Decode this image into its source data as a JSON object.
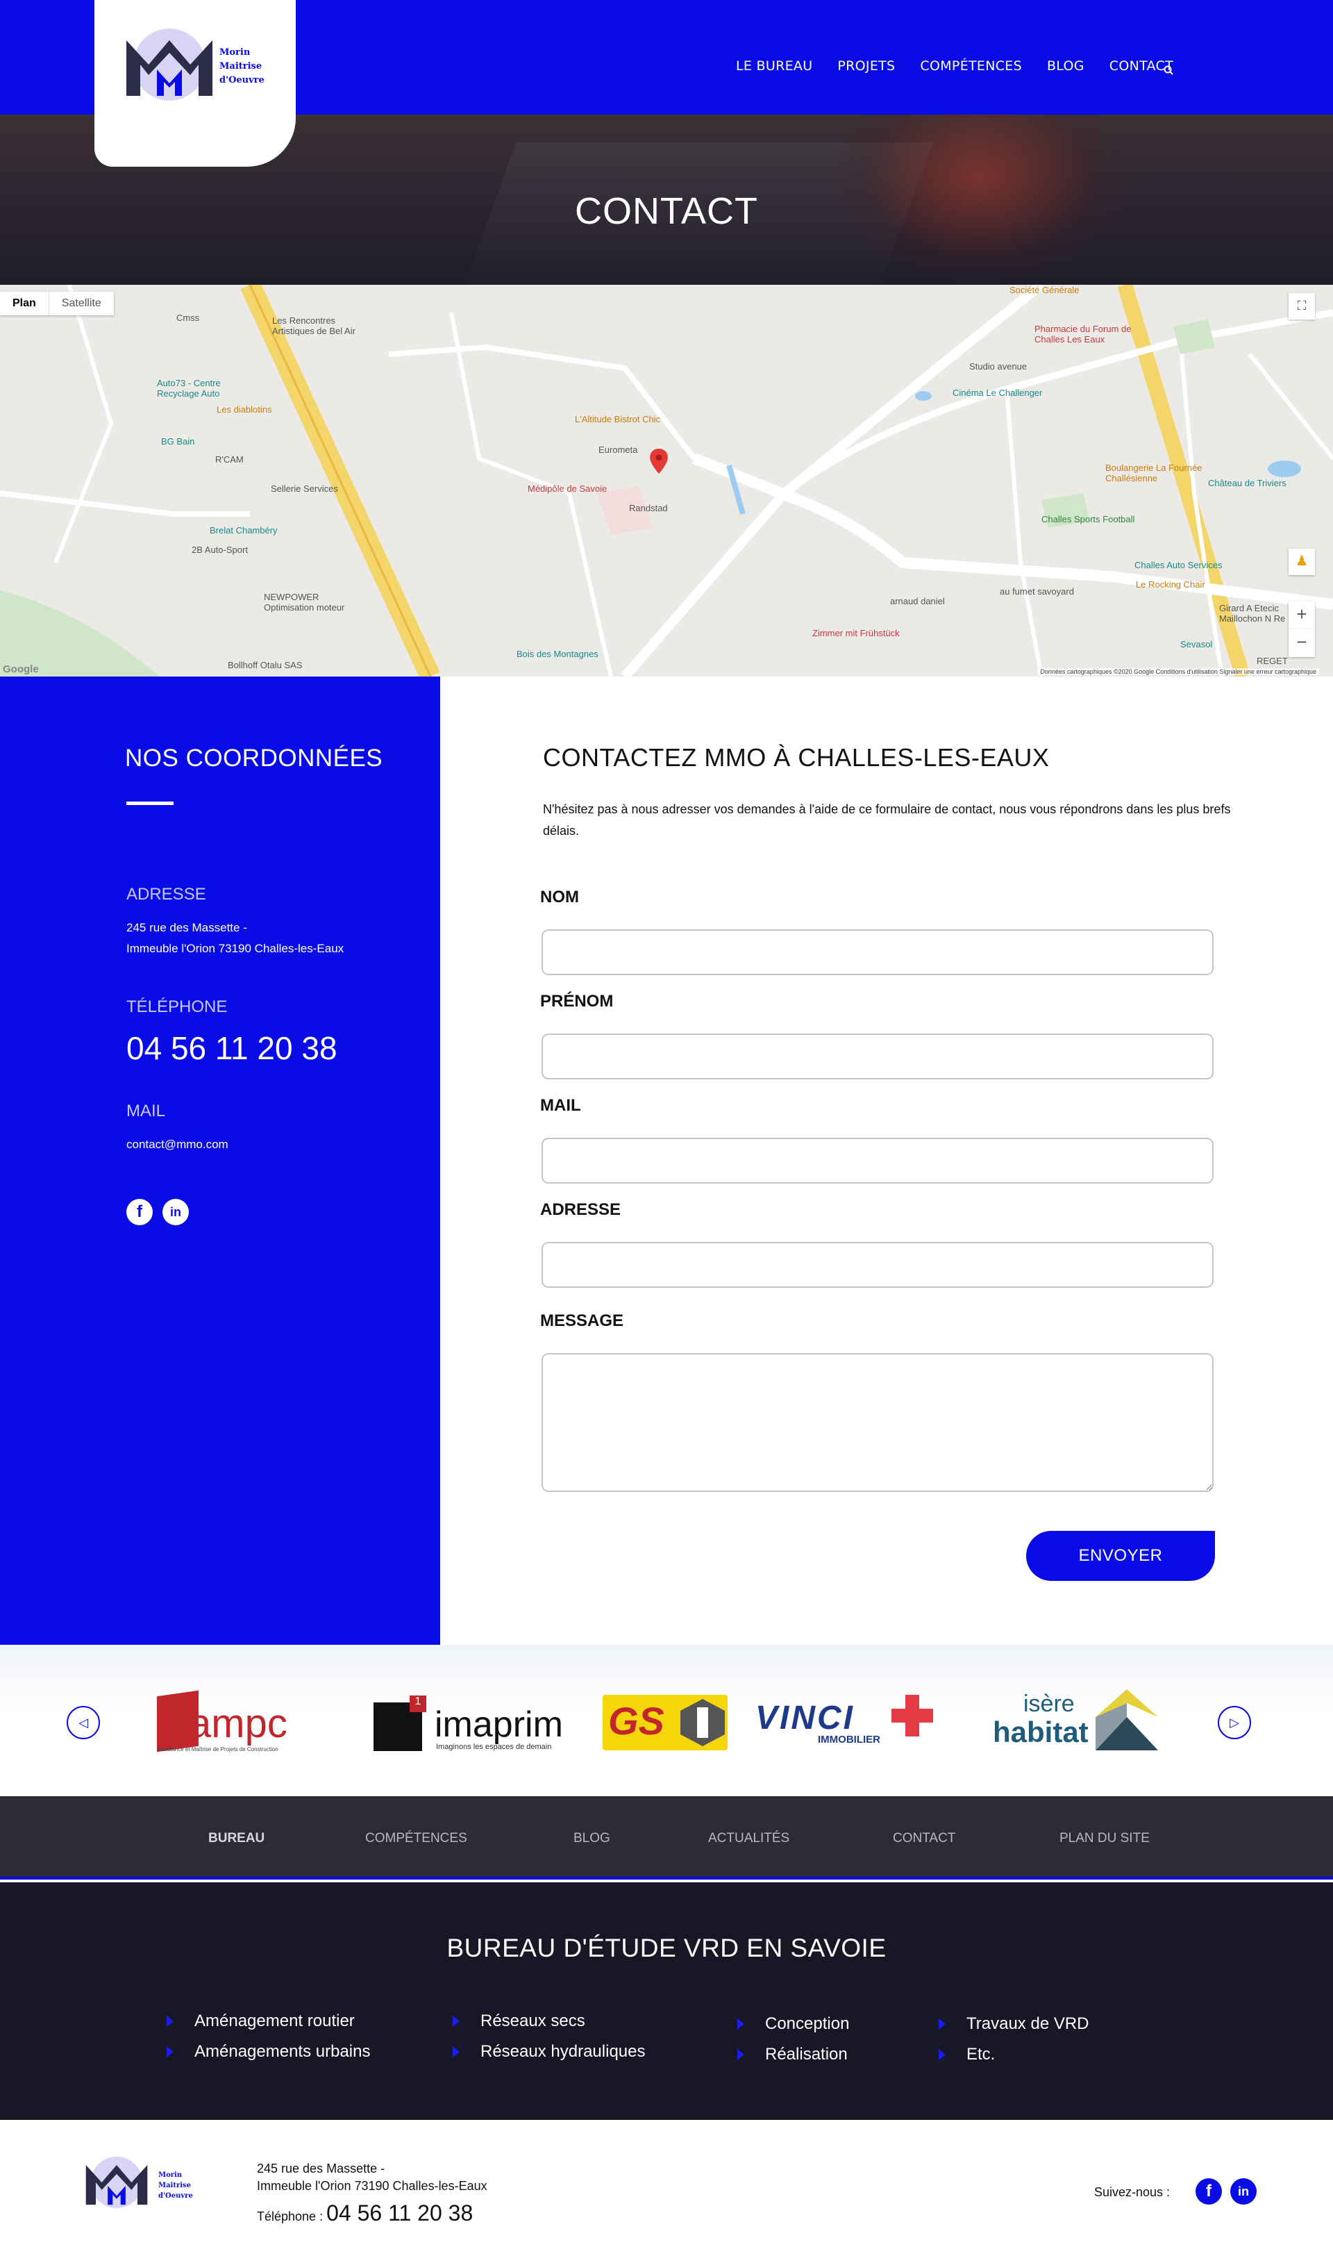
{
  "header": {
    "logo_text": [
      "Morin",
      "Maitrise",
      "d'Oeuvre"
    ],
    "nav": [
      "LE BUREAU",
      "PROJETS",
      "COMPÉTENCES",
      "BLOG",
      "CONTACT"
    ]
  },
  "hero": {
    "title": "CONTACT"
  },
  "map": {
    "tabs": [
      "Plan",
      "Satellite"
    ],
    "labels": [
      "Cmss",
      "Les Rencontres Artistiques de Bel Air",
      "Auto73 - Centre Recyclage Auto",
      "Les diablotins",
      "BG Bain",
      "R'CAM",
      "Sellerie Services",
      "Brelat Chambéry",
      "2B Auto-Sport",
      "NEWPOWER Optimisation moteur",
      "Bollhoff Otalu SAS",
      "L'Altitude Bistrot Chic",
      "Eurometa",
      "Médipôle de Savoie",
      "Randstad",
      "Bois des Montagnes",
      "Zimmer mit Frühstück",
      "arnaud daniel",
      "au fumet savoyard",
      "Studio avenue",
      "Cinéma Le Challenger",
      "Pharmacie du Forum de Challes Les Eaux",
      "Société Générale",
      "Boulangerie La Fournée Challésienne",
      "Challes Sports Football",
      "Château de Triviers",
      "Challes Auto Services",
      "Le Rocking Chair",
      "Sevasol",
      "Girard A Etecic Maillochon N Re",
      "REGET"
    ],
    "footer": "Données cartographiques ©2020 Google    Conditions d'utilisation    Signaler une erreur cartographique",
    "google": "Google"
  },
  "coordinates": {
    "title": "NOS COORDONNÉES",
    "address_label": "ADRESSE",
    "address_line1": "245 rue des Massette -",
    "address_line2": "Immeuble l'Orion 73190 Challes-les-Eaux",
    "phone_label": "TÉLÉPHONE",
    "phone": "04 56 11 20 38",
    "mail_label": "MAIL",
    "mail": "contact@mmo.com"
  },
  "form": {
    "title": "CONTACTEZ MMO À CHALLES-LES-EAUX",
    "intro": "N'hésitez pas à nous adresser vos demandes à l'aide de ce formulaire de contact, nous vous répondrons dans les plus brefs délais.",
    "labels": [
      "NOM",
      "PRÉNOM",
      "MAIL",
      "ADRESSE",
      "MESSAGE"
    ],
    "submit": "ENVOYER"
  },
  "partners": [
    "ampc",
    "Assistance et Maîtrise de Projets de Construction",
    "imaprim",
    "Imaginons les espaces de demain",
    "GS",
    "VINCI",
    "IMMOBILIER",
    "isère",
    "habitat"
  ],
  "footer_nav": [
    "BUREAU",
    "COMPÉTENCES",
    "BLOG",
    "ACTUALITÉS",
    "CONTACT",
    "PLAN DU SITE"
  ],
  "services": {
    "title": "BUREAU D'ÉTUDE VRD EN SAVOIE",
    "items": [
      "Aménagement routier",
      "Aménagements urbains",
      "Réseaux secs",
      "Réseaux hydrauliques",
      "Conception",
      "Réalisation",
      "Travaux de VRD",
      "Etc."
    ]
  },
  "bottom": {
    "address_line1": "245 rue des Massette -",
    "address_line2": "Immeuble l'Orion 73190 Challes-les-Eaux",
    "tel_label": "Téléphone :",
    "tel": "04 56 11 20 38",
    "follow": "Suivez-nous :"
  },
  "colors": {
    "brand_blue": "#0a0ce6",
    "dark_nav": "#2c2c36",
    "dark_services": "#171726"
  }
}
